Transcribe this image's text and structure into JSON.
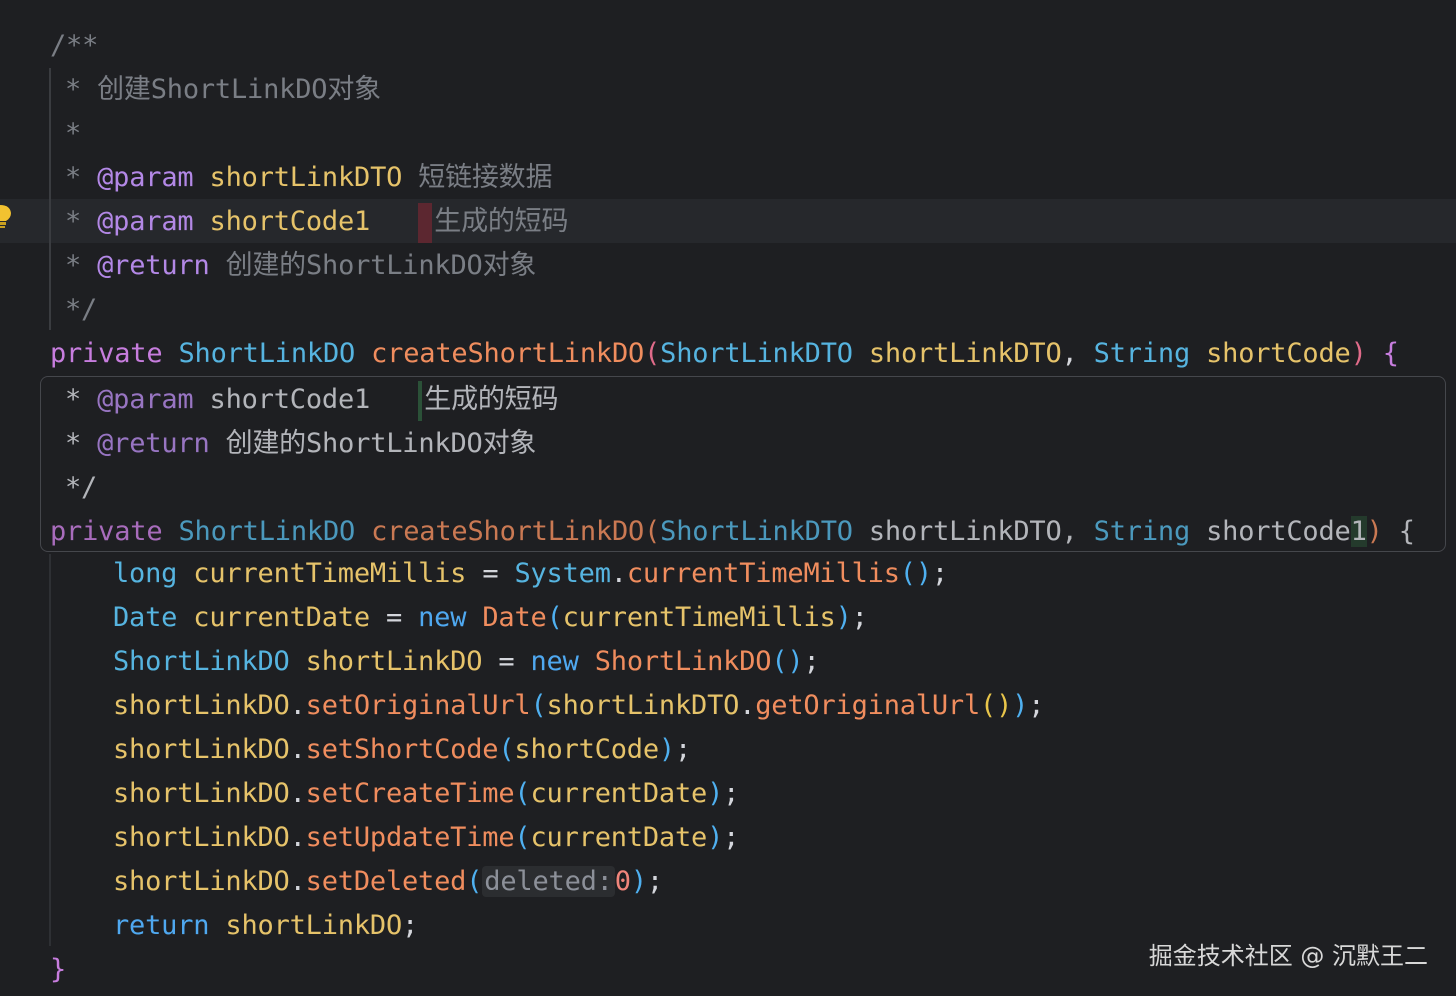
{
  "editor": {
    "doc_open": "/**",
    "doc_line1": "* 创建ShortLinkDO对象",
    "doc_star": "*",
    "param1": {
      "star": "*",
      "tag": "@param",
      "name": "shortLinkDTO",
      "desc": "短链接数据"
    },
    "param2": {
      "star": "*",
      "tag": "@param",
      "name": "shortCode1",
      "desc": "生成的短码"
    },
    "ret": {
      "star": "*",
      "tag": "@return",
      "desc": "创建的ShortLinkDO对象"
    },
    "doc_close": "*/",
    "signature": {
      "kw": "private",
      "ret_type": "ShortLinkDO",
      "fn": "createShortLinkDO",
      "open": "(",
      "p1_type": "ShortLinkDTO",
      "p1_name": "shortLinkDTO",
      "comma": ",",
      "p2_type": "String",
      "p2_name": "shortCode",
      "close": ")",
      "brace": "{"
    },
    "diff_preview": {
      "param": {
        "star": "*",
        "tag": "@param",
        "name": "shortCode1",
        "desc": "生成的短码"
      },
      "ret": {
        "star": "*",
        "tag": "@return",
        "desc": "创建的ShortLinkDO对象"
      },
      "close": "*/",
      "signature": {
        "kw": "private",
        "ret_type": "ShortLinkDO",
        "fn": "createShortLinkDO",
        "open": "(",
        "p1_type": "ShortLinkDTO",
        "p1_name": "shortLinkDTO",
        "comma": ",",
        "p2_type": "String",
        "p2_name_a": "shortCode",
        "p2_name_b": "1",
        "close": ")",
        "brace": "{"
      }
    },
    "body": {
      "l1": {
        "type": "long",
        "var": "currentTimeMillis",
        "eq": "=",
        "cls": "System",
        "dot": ".",
        "fn": "currentTimeMillis",
        "args": "()",
        "end": ";"
      },
      "l2": {
        "type": "Date",
        "var": "currentDate",
        "eq": "=",
        "kw": "new",
        "cls": "Date",
        "open": "(",
        "arg": "currentTimeMillis",
        "close": ")",
        "end": ";"
      },
      "l3": {
        "type": "ShortLinkDO",
        "var": "shortLinkDO",
        "eq": "=",
        "kw": "new",
        "cls": "ShortLinkDO",
        "args": "()",
        "end": ";"
      },
      "l4": {
        "obj": "shortLinkDO",
        "dot": ".",
        "fn": "setOriginalUrl",
        "open": "(",
        "arg_obj": "shortLinkDTO",
        "dot2": ".",
        "arg_fn": "getOriginalUrl",
        "arg_args": "()",
        "close": ")",
        "end": ";"
      },
      "l5": {
        "obj": "shortLinkDO",
        "dot": ".",
        "fn": "setShortCode",
        "open": "(",
        "arg": "shortCode",
        "close": ")",
        "end": ";"
      },
      "l6": {
        "obj": "shortLinkDO",
        "dot": ".",
        "fn": "setCreateTime",
        "open": "(",
        "arg": "currentDate",
        "close": ")",
        "end": ";"
      },
      "l7": {
        "obj": "shortLinkDO",
        "dot": ".",
        "fn": "setUpdateTime",
        "open": "(",
        "arg": "currentDate",
        "close": ")",
        "end": ";"
      },
      "l8": {
        "obj": "shortLinkDO",
        "dot": ".",
        "fn": "setDeleted",
        "open": "(",
        "hint": "deleted:",
        "arg": "0",
        "close": ")",
        "end": ";"
      },
      "l9": {
        "kw": "return",
        "var": "shortLinkDO",
        "end": ";"
      }
    },
    "closing_brace": "}"
  },
  "watermark": "掘金技术社区 @ 沉默王二",
  "icons": {
    "intention": "lightbulb-icon"
  }
}
